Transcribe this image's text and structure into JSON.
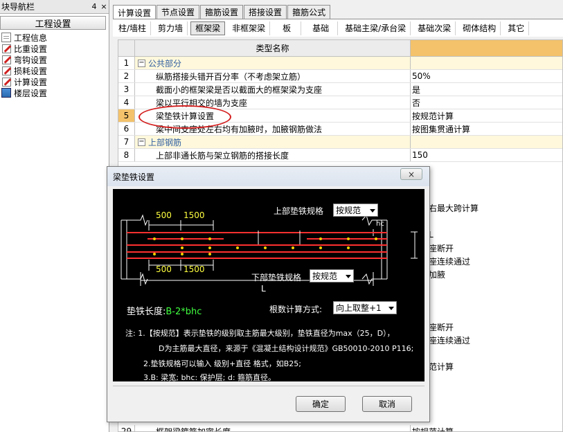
{
  "nav": {
    "title": "块导航栏",
    "pin": "4",
    "close": "×",
    "header": "工程设置",
    "items": [
      {
        "label": "工程信息",
        "icon": "document-icon"
      },
      {
        "label": "比重设置",
        "icon": "edit-icon"
      },
      {
        "label": "弯钩设置",
        "icon": "edit-icon"
      },
      {
        "label": "损耗设置",
        "icon": "edit-icon"
      },
      {
        "label": "计算设置",
        "icon": "edit-icon"
      },
      {
        "label": "楼层设置",
        "icon": "layers-icon"
      }
    ]
  },
  "tabs": [
    "计算设置",
    "节点设置",
    "箍筋设置",
    "搭接设置",
    "箍筋公式"
  ],
  "subtabs": [
    "柱/墙柱",
    "剪力墙",
    "框架梁",
    "非框架梁",
    "板",
    "基础",
    "基础主梁/承台梁",
    "基础次梁",
    "砌体结构",
    "其它"
  ],
  "grid": {
    "header": "类型名称",
    "rows": [
      {
        "num": "1",
        "name": "公共部分",
        "value": "",
        "group": true
      },
      {
        "num": "2",
        "name": "纵筋搭接头错开百分率（不考虑架立筋）",
        "value": "50%"
      },
      {
        "num": "3",
        "name": "截面小的框架梁是否以截面大的框架梁为支座",
        "value": "是"
      },
      {
        "num": "4",
        "name": "梁以平行相交的墙为支座",
        "value": "否"
      },
      {
        "num": "5",
        "name": "梁垫铁计算设置",
        "value": "按规范计算"
      },
      {
        "num": "6",
        "name": "梁中间支座处左右均有加腋时，加腋钢筋做法",
        "value": "按图集贯通计算"
      },
      {
        "num": "7",
        "name": "上部钢筋",
        "value": "",
        "group": true
      },
      {
        "num": "8",
        "name": "上部非通长筋与架立钢筋的搭接长度",
        "value": "150"
      },
      {
        "num": "29",
        "name": "框架梁箍筋加密长度",
        "value": "按规范计算"
      }
    ],
    "partial_values": [
      "右最大跨计算",
      "L",
      "座断开",
      "座连续通过",
      "加腋",
      "座断开",
      "座连续通过",
      "范计算"
    ]
  },
  "dialog": {
    "title": "梁垫铁设置",
    "close": "×",
    "top_spec_label": "上部垫铁规格",
    "top_spec_value": "按规范",
    "bottom_spec_label": "下部垫铁规格",
    "bottom_spec_value": "按规范",
    "dim_500_top": "500",
    "dim_1500_top": "1500",
    "dim_500_bot": "500",
    "dim_1500_bot": "1500",
    "hc": "hc",
    "L": "L",
    "length_label": "垫铁长度:",
    "length_formula": "B-2*bhc",
    "count_label": "根数计算方式:",
    "count_value": "向上取整+1",
    "note1a": "注: 1.【按规范】表示垫铁的级别取主筋最大级别，垫铁直径为max（25，D），",
    "note1b": "D为主筋最大直径，来源于《混凝土结构设计规范》GB50010-2010 P116;",
    "note2": "2.垫铁规格可以输入 级别+直径 格式，如B25;",
    "note3": "3.B: 梁宽; bhc: 保护层; d: 箍筋直径。",
    "ok": "确定",
    "cancel": "取消"
  }
}
